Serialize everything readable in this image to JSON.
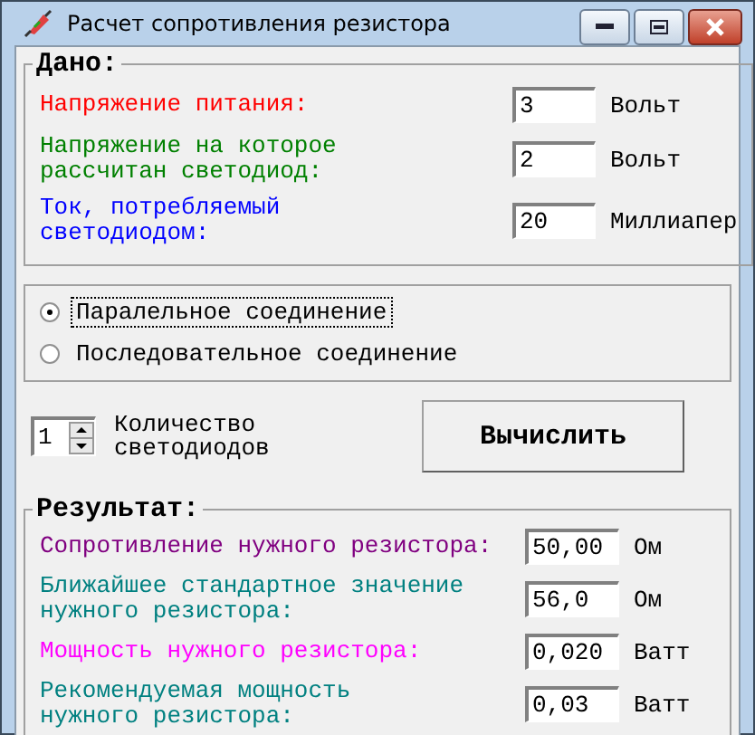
{
  "window": {
    "title": "Расчет сопротивления резистора"
  },
  "inputs": {
    "title": "Дано:",
    "rows": [
      {
        "label": "Напряжение питания:",
        "color": "#ff0000",
        "value": "3",
        "unit": "Вольт"
      },
      {
        "label": "Напряжение на которое\nрассчитан светодиод:",
        "color": "#008000",
        "value": "2",
        "unit": "Вольт"
      },
      {
        "label": "Ток, потребляемый\nсветодиодом:",
        "color": "#0000ff",
        "value": "20",
        "unit": "Миллиапер"
      }
    ]
  },
  "connection": [
    {
      "label": "Паралельное соединение",
      "selected": true
    },
    {
      "label": "Последовательное соединение",
      "selected": false
    }
  ],
  "led_count": {
    "value": "1",
    "label": "Количество\nсветодиодов"
  },
  "calculate_button": "Вычислить",
  "results": {
    "title": "Результат:",
    "rows": [
      {
        "label": "Сопротивление нужного резистора:",
        "color": "#800080",
        "value": "50,00",
        "unit": "Ом"
      },
      {
        "label": "Ближайшее стандартное значение\nнужного резистора:",
        "color": "#008080",
        "value": "56,0",
        "unit": "Ом"
      },
      {
        "label": "Мощность нужного резистора:",
        "color": "#ff00ff",
        "value": "0,020",
        "unit": "Ватт"
      },
      {
        "label": "Рекомендуемая мощность\nнужного резистора:",
        "color": "#008080",
        "value": "0,03",
        "unit": "Ватт"
      }
    ]
  }
}
